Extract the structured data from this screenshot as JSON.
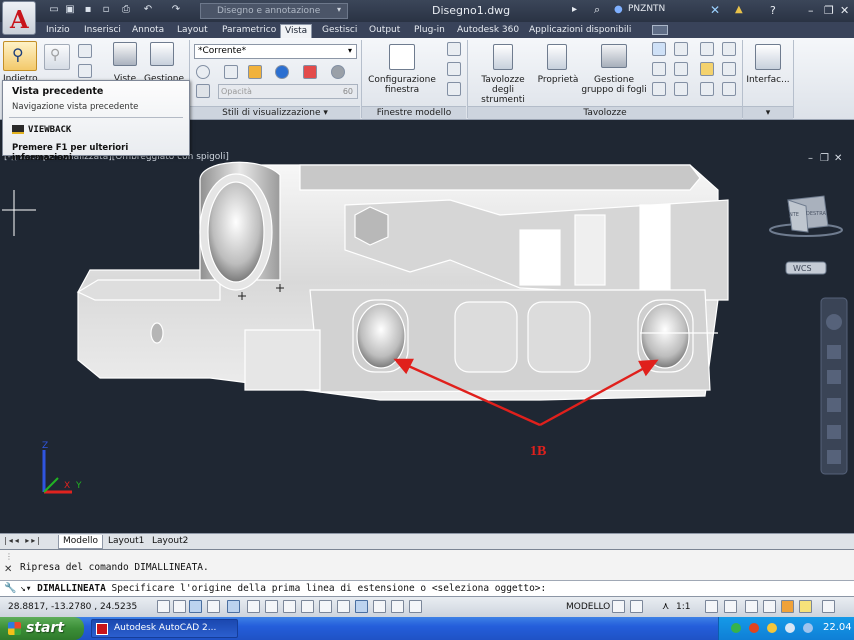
{
  "titlebar": {
    "workspace": "Disegno e annotazione",
    "document_title": "Disegno1.dwg",
    "user": "PNZNTN",
    "app_logo": "A"
  },
  "ribbon_tabs": [
    "Inizio",
    "Inserisci",
    "Annota",
    "Layout",
    "Parametrico",
    "Vista",
    "Gestisci",
    "Output",
    "Plug-in",
    "Autodesk 360",
    "Applicazioni disponibili"
  ],
  "active_tab": "Vista",
  "ribbon": {
    "indietro_label": "Indietro",
    "viste_label": "Viste",
    "gestione_label": "Gestione",
    "visual_style": "*Corrente*",
    "opacita_placeholder": "Opacità",
    "opacita_value": "60",
    "panel_stili": "Stili di visualizzazione",
    "config_finestra": "Configurazione finestra",
    "panel_finestre": "Finestre modello",
    "tavolozze_strumenti": "Tavolozze degli strumenti",
    "proprieta": "Proprietà",
    "gestione_gruppo": "Gestione gruppo di fogli",
    "panel_tavolozze": "Tavolozze",
    "interfaccia": "Interfac..."
  },
  "tooltip": {
    "title": "Vista precedente",
    "description": "Navigazione vista precedente",
    "command": "VIEWBACK",
    "help": "Premere F1 per ulteriori informazioni"
  },
  "viewport": {
    "label": "[-][Vista personalizzata][Ombreggiato con spigoli]",
    "annotation": "1B",
    "viewcube_face": "DESTRA",
    "viewcube_face_left": "NTE",
    "wcs": "WCS",
    "ucs_z": "Z",
    "ucs_x": "X",
    "ucs_y": "Y"
  },
  "layout_tabs": [
    "Modello",
    "Layout1",
    "Layout2"
  ],
  "command": {
    "history": "Ripresa del comando DIMALLINEATA.",
    "prompt_command": "DIMALLINEATA",
    "prompt_text": "Specificare l'origine della prima linea di estensione o <seleziona oggetto>:"
  },
  "statusbar": {
    "coordinates": "28.8817, -13.2780 , 24.5235",
    "space": "MODELLO",
    "scale": "1:1"
  },
  "taskbar": {
    "start": "start",
    "app": "Autodesk AutoCAD 2...",
    "clock": "22.04"
  },
  "colors": {
    "annotation_red": "#e0201c",
    "viewport_bg": "#1f2733",
    "title_bar": "#2f394b"
  }
}
